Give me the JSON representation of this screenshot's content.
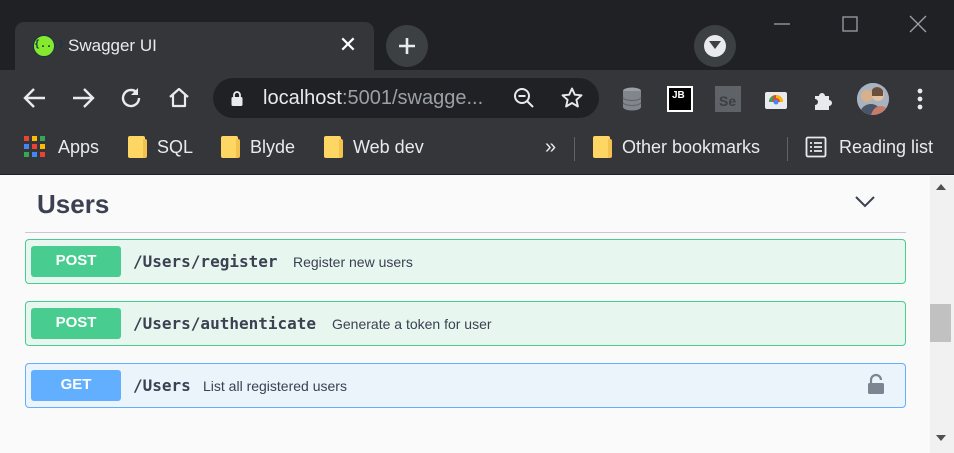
{
  "browser": {
    "tab": {
      "title": "Swagger UI",
      "favicon_glyph": "{...}",
      "close_glyph": "✕"
    },
    "address": {
      "host": "localhost",
      "rest": ":5001/swagge..."
    },
    "bookmarks": [
      {
        "label": "Apps",
        "icon": "apps-grid-icon"
      },
      {
        "label": "SQL",
        "icon": "folder-icon"
      },
      {
        "label": "Blyde",
        "icon": "folder-icon"
      },
      {
        "label": "Web dev",
        "icon": "folder-icon"
      }
    ],
    "bookmarks_overflow": "»",
    "other_bookmarks": "Other bookmarks",
    "reading_list": "Reading list",
    "extensions": [
      "database-icon",
      "jb-icon",
      "selenium-icon",
      "chrome-webstore-icon",
      "extensions-puzzle-icon",
      "profile-avatar",
      "menu-kebab-icon"
    ],
    "extension_labels": {
      "jb": "JB",
      "se": "Se"
    }
  },
  "section": {
    "title": "Users",
    "expanded": true
  },
  "operations": [
    {
      "method": "POST",
      "path": "/Users/register",
      "summary": "Register new users",
      "locked": false
    },
    {
      "method": "POST",
      "path": "/Users/authenticate",
      "summary": "Generate a token for user",
      "locked": false
    },
    {
      "method": "GET",
      "path": "/Users",
      "summary": "List all registered users",
      "locked": true
    }
  ],
  "colors": {
    "post": "#49cc90",
    "get": "#61affe",
    "title": "#3b4151"
  }
}
